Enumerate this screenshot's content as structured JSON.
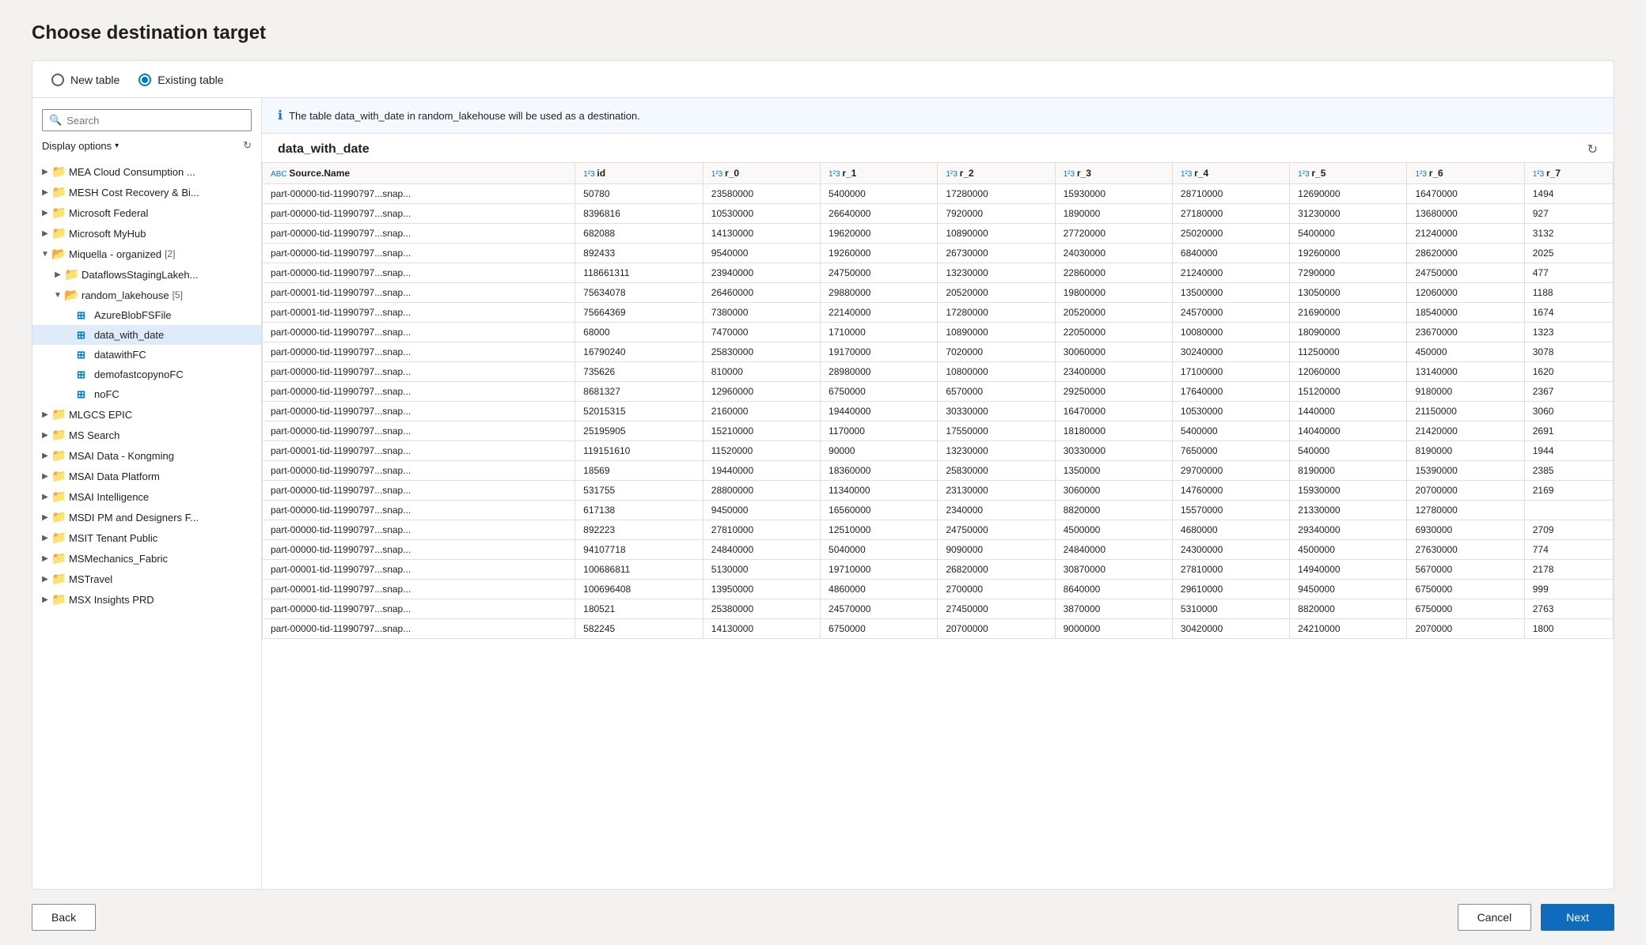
{
  "page": {
    "title": "Choose destination target"
  },
  "tabs": {
    "new_table": "New table",
    "existing_table": "Existing table"
  },
  "left_panel": {
    "search_placeholder": "Search",
    "display_options": "Display options",
    "tree_items": [
      {
        "id": "mea",
        "label": "MEA Cloud Consumption ...",
        "type": "folder",
        "indent": 1,
        "expanded": false,
        "arrow": "▶"
      },
      {
        "id": "mesh",
        "label": "MESH Cost Recovery & Bi...",
        "type": "folder",
        "indent": 1,
        "expanded": false,
        "arrow": "▶"
      },
      {
        "id": "msfederal",
        "label": "Microsoft Federal",
        "type": "folder",
        "indent": 1,
        "expanded": false,
        "arrow": "▶"
      },
      {
        "id": "mymhub",
        "label": "Microsoft MyHub",
        "type": "folder",
        "indent": 1,
        "expanded": false,
        "arrow": "▶"
      },
      {
        "id": "miquellaorg",
        "label": "Miquella - organized",
        "badge": "[2]",
        "type": "folder",
        "indent": 1,
        "expanded": true,
        "arrow": "▼"
      },
      {
        "id": "dataflows",
        "label": "DataflowsStagingLakeh...",
        "type": "folder",
        "indent": 2,
        "expanded": false,
        "arrow": "▶"
      },
      {
        "id": "random_lh",
        "label": "random_lakehouse",
        "badge": "[5]",
        "type": "folder",
        "indent": 2,
        "expanded": true,
        "arrow": "▼"
      },
      {
        "id": "azureblob",
        "label": "AzureBlobFSFile",
        "type": "table",
        "indent": 3,
        "expanded": false,
        "arrow": ""
      },
      {
        "id": "data_with_date",
        "label": "data_with_date",
        "type": "table",
        "indent": 3,
        "expanded": false,
        "arrow": "",
        "selected": true
      },
      {
        "id": "datawithfc",
        "label": "datawithFC",
        "type": "table",
        "indent": 3,
        "expanded": false,
        "arrow": ""
      },
      {
        "id": "demofastcopy",
        "label": "demofastcopynoFC",
        "type": "table",
        "indent": 3,
        "expanded": false,
        "arrow": ""
      },
      {
        "id": "nofc",
        "label": "noFC",
        "type": "table",
        "indent": 3,
        "expanded": false,
        "arrow": ""
      },
      {
        "id": "mlgcs",
        "label": "MLGCS EPIC",
        "type": "folder",
        "indent": 1,
        "expanded": false,
        "arrow": "▶"
      },
      {
        "id": "mssearch",
        "label": "MS Search",
        "type": "folder",
        "indent": 1,
        "expanded": false,
        "arrow": "▶"
      },
      {
        "id": "msai_kong",
        "label": "MSAI Data - Kongming",
        "type": "folder",
        "indent": 1,
        "expanded": false,
        "arrow": "▶"
      },
      {
        "id": "msai_plat",
        "label": "MSAI Data Platform",
        "type": "folder",
        "indent": 1,
        "expanded": false,
        "arrow": "▶"
      },
      {
        "id": "msai_intel",
        "label": "MSAI Intelligence",
        "type": "folder",
        "indent": 1,
        "expanded": false,
        "arrow": "▶"
      },
      {
        "id": "msdi_pm",
        "label": "MSDI PM and Designers F...",
        "type": "folder",
        "indent": 1,
        "expanded": false,
        "arrow": "▶"
      },
      {
        "id": "msit_tenant",
        "label": "MSIT Tenant Public",
        "type": "folder",
        "indent": 1,
        "expanded": false,
        "arrow": "▶"
      },
      {
        "id": "msmech",
        "label": "MSMechanics_Fabric",
        "type": "folder",
        "indent": 1,
        "expanded": false,
        "arrow": "▶"
      },
      {
        "id": "mstravel",
        "label": "MSTravel",
        "type": "folder",
        "indent": 1,
        "expanded": false,
        "arrow": "▶"
      },
      {
        "id": "msxinsights",
        "label": "MSX Insights PRD",
        "type": "folder",
        "indent": 1,
        "expanded": false,
        "arrow": "▶"
      }
    ]
  },
  "right_panel": {
    "info_message": "The table data_with_date in random_lakehouse will be used as a destination.",
    "table_name": "data_with_date",
    "columns": [
      {
        "name": "Source.Name",
        "type": "ABC"
      },
      {
        "name": "id",
        "type": "1²3"
      },
      {
        "name": "r_0",
        "type": "1²3"
      },
      {
        "name": "r_1",
        "type": "1²3"
      },
      {
        "name": "r_2",
        "type": "1²3"
      },
      {
        "name": "r_3",
        "type": "1²3"
      },
      {
        "name": "r_4",
        "type": "1²3"
      },
      {
        "name": "r_5",
        "type": "1²3"
      },
      {
        "name": "r_6",
        "type": "1²3"
      },
      {
        "name": "r_7",
        "type": "1²3"
      }
    ],
    "rows": [
      [
        "part-00000-tid-11990797...snap...",
        "50780",
        "23580000",
        "5400000",
        "17280000",
        "15930000",
        "28710000",
        "12690000",
        "16470000",
        "1494"
      ],
      [
        "part-00000-tid-11990797...snap...",
        "8396816",
        "10530000",
        "26640000",
        "7920000",
        "1890000",
        "27180000",
        "31230000",
        "13680000",
        "927"
      ],
      [
        "part-00000-tid-11990797...snap...",
        "682088",
        "14130000",
        "19620000",
        "10890000",
        "27720000",
        "25020000",
        "5400000",
        "21240000",
        "3132"
      ],
      [
        "part-00000-tid-11990797...snap...",
        "892433",
        "9540000",
        "19260000",
        "26730000",
        "24030000",
        "6840000",
        "19260000",
        "28620000",
        "2025"
      ],
      [
        "part-00000-tid-11990797...snap...",
        "118661311",
        "23940000",
        "24750000",
        "13230000",
        "22860000",
        "21240000",
        "7290000",
        "24750000",
        "477"
      ],
      [
        "part-00001-tid-11990797...snap...",
        "75634078",
        "26460000",
        "29880000",
        "20520000",
        "19800000",
        "13500000",
        "13050000",
        "12060000",
        "1188"
      ],
      [
        "part-00001-tid-11990797...snap...",
        "75664369",
        "7380000",
        "22140000",
        "17280000",
        "20520000",
        "24570000",
        "21690000",
        "18540000",
        "1674"
      ],
      [
        "part-00000-tid-11990797...snap...",
        "68000",
        "7470000",
        "1710000",
        "10890000",
        "22050000",
        "10080000",
        "18090000",
        "23670000",
        "1323"
      ],
      [
        "part-00000-tid-11990797...snap...",
        "16790240",
        "25830000",
        "19170000",
        "7020000",
        "30060000",
        "30240000",
        "11250000",
        "450000",
        "3078"
      ],
      [
        "part-00000-tid-11990797...snap...",
        "735626",
        "810000",
        "28980000",
        "10800000",
        "23400000",
        "17100000",
        "12060000",
        "13140000",
        "1620"
      ],
      [
        "part-00000-tid-11990797...snap...",
        "8681327",
        "12960000",
        "6750000",
        "6570000",
        "29250000",
        "17640000",
        "15120000",
        "9180000",
        "2367"
      ],
      [
        "part-00000-tid-11990797...snap...",
        "52015315",
        "2160000",
        "19440000",
        "30330000",
        "16470000",
        "10530000",
        "1440000",
        "21150000",
        "3060"
      ],
      [
        "part-00000-tid-11990797...snap...",
        "25195905",
        "15210000",
        "1170000",
        "17550000",
        "18180000",
        "5400000",
        "14040000",
        "21420000",
        "2691"
      ],
      [
        "part-00001-tid-11990797...snap...",
        "119151610",
        "11520000",
        "90000",
        "13230000",
        "30330000",
        "7650000",
        "540000",
        "8190000",
        "1944"
      ],
      [
        "part-00000-tid-11990797...snap...",
        "18569",
        "19440000",
        "18360000",
        "25830000",
        "1350000",
        "29700000",
        "8190000",
        "15390000",
        "2385"
      ],
      [
        "part-00000-tid-11990797...snap...",
        "531755",
        "28800000",
        "11340000",
        "23130000",
        "3060000",
        "14760000",
        "15930000",
        "20700000",
        "2169"
      ],
      [
        "part-00000-tid-11990797...snap...",
        "617138",
        "9450000",
        "16560000",
        "2340000",
        "8820000",
        "15570000",
        "21330000",
        "12780000",
        ""
      ],
      [
        "part-00000-tid-11990797...snap...",
        "892223",
        "27810000",
        "12510000",
        "24750000",
        "4500000",
        "4680000",
        "29340000",
        "6930000",
        "2709"
      ],
      [
        "part-00000-tid-11990797...snap...",
        "94107718",
        "24840000",
        "5040000",
        "9090000",
        "24840000",
        "24300000",
        "4500000",
        "27630000",
        "774"
      ],
      [
        "part-00001-tid-11990797...snap...",
        "100686811",
        "5130000",
        "19710000",
        "26820000",
        "30870000",
        "27810000",
        "14940000",
        "5670000",
        "2178"
      ],
      [
        "part-00001-tid-11990797...snap...",
        "100696408",
        "13950000",
        "4860000",
        "2700000",
        "8640000",
        "29610000",
        "9450000",
        "6750000",
        "999"
      ],
      [
        "part-00000-tid-11990797...snap...",
        "180521",
        "25380000",
        "24570000",
        "27450000",
        "3870000",
        "5310000",
        "8820000",
        "6750000",
        "2763"
      ],
      [
        "part-00000-tid-11990797...snap...",
        "582245",
        "14130000",
        "6750000",
        "20700000",
        "9000000",
        "30420000",
        "24210000",
        "2070000",
        "1800"
      ]
    ]
  },
  "footer": {
    "back_label": "Back",
    "cancel_label": "Cancel",
    "next_label": "Next"
  }
}
